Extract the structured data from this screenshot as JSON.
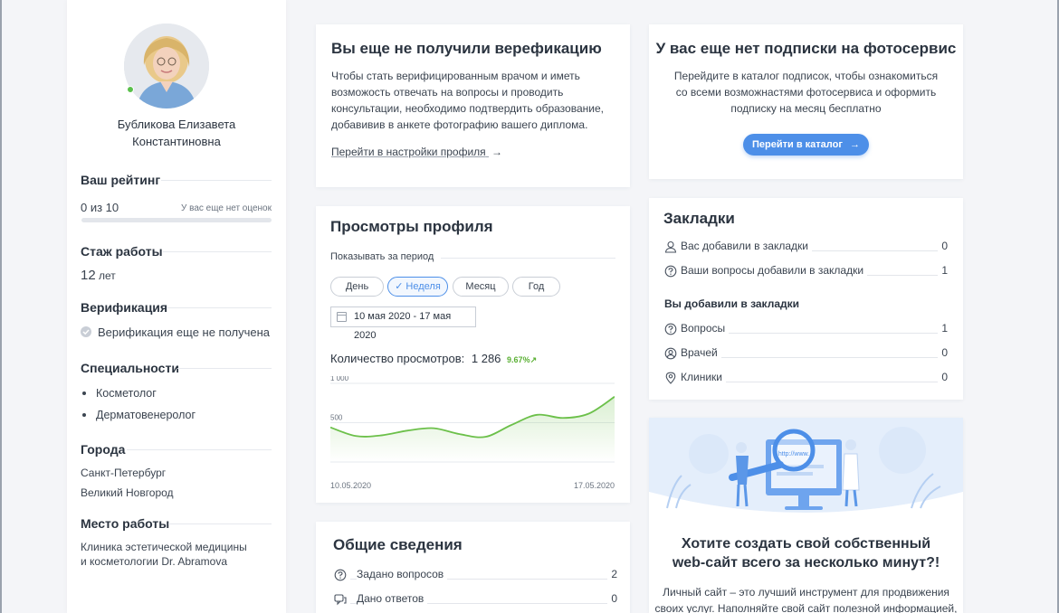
{
  "profile": {
    "name_line1": "Бубликова Елизавета",
    "name_line2": "Константиновна"
  },
  "rating": {
    "title": "Ваш рейтинг",
    "value": "0 из 10",
    "note": "У вас еще нет оценок",
    "progress": 0
  },
  "experience": {
    "title": "Стаж работы",
    "value": "12",
    "unit": "лет"
  },
  "verification": {
    "title": "Верификация",
    "status": "Верификация еще не получена"
  },
  "specialties": {
    "title": "Специальности",
    "items": [
      "Косметолог",
      "Дерматовенеролог"
    ]
  },
  "cities": {
    "title": "Города",
    "items": [
      "Санкт-Петербург",
      "Великий Новгород"
    ]
  },
  "workplace": {
    "title": "Место работы",
    "line1": "Клиника эстетической медицины",
    "line2": "и косметологии Dr. Abramova"
  },
  "verify_card": {
    "title": "Вы еще не получили верефикацию",
    "lines": [
      "Чтобы стать верифицированным врачом и иметь",
      "возможость отвечать на вопросы и проводить",
      "консультации, необходимо подтвердить образование,",
      "добавивив в анкете фотографию вашего диплома."
    ],
    "link": "Перейти в настройки профиля",
    "arrow": "→"
  },
  "photo_card": {
    "title": "У вас еще нет подписки на фотосервис",
    "lines": [
      "Перейдите в каталог подписок, чтобы ознакомиться",
      "со всеми возможнастями фотосервиса и оформить",
      "подписку на месяц бесплатно"
    ],
    "button": "Перейти в каталог",
    "arrow": "→"
  },
  "views_card": {
    "title": "Просмотры профиля",
    "period_label": "Показывать за период",
    "periods": [
      "День",
      "Неделя",
      "Месяц",
      "Год"
    ],
    "active_period": "Неделя",
    "check": "✓",
    "date_range": "10 мая 2020 - 17 мая 2020",
    "count_label": "Количество просмотров:",
    "count_value": "1 286",
    "growth": "9.67%",
    "growth_arrow": "↗"
  },
  "chart_data": {
    "type": "area",
    "x_start": "10.05.2020",
    "x_end": "17.05.2020",
    "y_ticks": [
      "1 000",
      "500"
    ],
    "ylim": [
      0,
      1000
    ],
    "values": [
      440,
      330,
      340,
      400,
      430,
      355,
      320,
      470,
      600,
      560,
      615,
      830
    ],
    "color": "#6cc04a",
    "grid": true
  },
  "bookmarks": {
    "title": "Закладки",
    "rows": [
      {
        "icon": "user-icon",
        "label": "Вас добавили в закладки",
        "value": "0"
      },
      {
        "icon": "question-icon",
        "label": "Ваши вопросы добавили в закладки",
        "value": "1"
      }
    ],
    "sub_title": "Вы добавили в закладки",
    "rows2": [
      {
        "icon": "question-icon",
        "label": "Вопросы",
        "value": "1"
      },
      {
        "icon": "doctor-icon",
        "label": "Врачей",
        "value": "0"
      },
      {
        "icon": "pin-icon",
        "label": "Клиники",
        "value": "0"
      }
    ]
  },
  "general": {
    "title": "Общие сведения",
    "rows": [
      {
        "icon": "question-icon",
        "label": "Задано вопросов",
        "value": "2"
      },
      {
        "icon": "chat-icon",
        "label": "Дано ответов",
        "value": "0"
      }
    ]
  },
  "promo": {
    "url_text": "http://www.",
    "title_line1": "Хотите создать свой собственный",
    "title_line2": "web-сайт всего за несколько минут?!",
    "text_line1": "Личный сайт – это лучший инструмент для продвижения",
    "text_line2": "своих услуг. Наполняйте свой сайт полезной информацией,"
  },
  "colors": {
    "accent": "#4d8fe8",
    "online": "#5ac04b",
    "growth": "#5ab034"
  }
}
